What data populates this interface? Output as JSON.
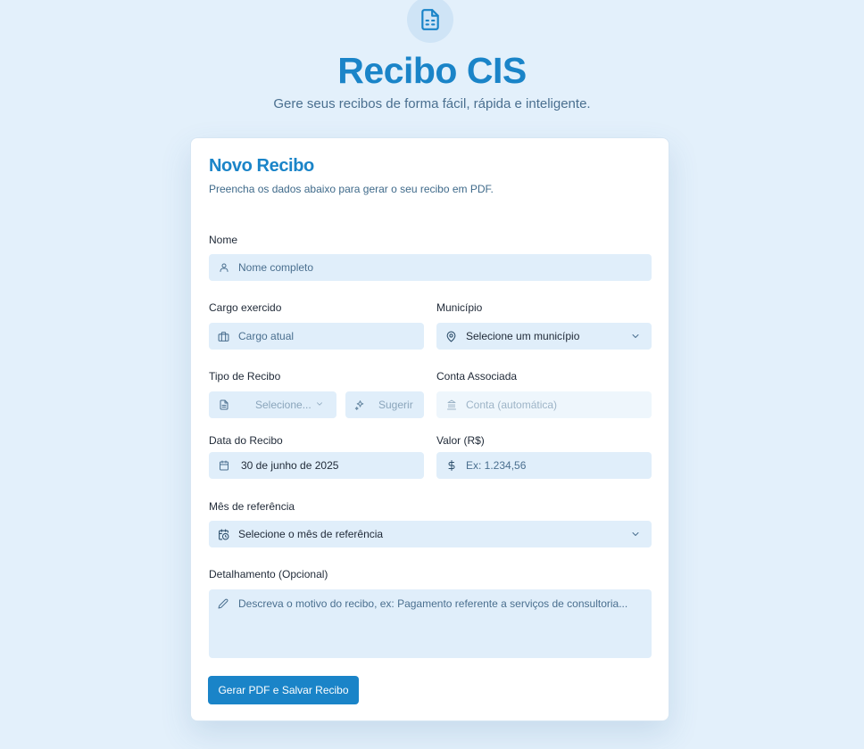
{
  "header": {
    "icon": "file-spreadsheet-icon",
    "title": "Recibo CIS",
    "subtitle": "Gere seus recibos de forma fácil, rápida e inteligente."
  },
  "form": {
    "title": "Novo Recibo",
    "description": "Preencha os dados abaixo para gerar o seu recibo em PDF.",
    "nome": {
      "label": "Nome",
      "placeholder": "Nome completo",
      "icon": "user-icon"
    },
    "cargo": {
      "label": "Cargo exercido",
      "placeholder": "Cargo atual",
      "icon": "briefcase-icon"
    },
    "municipio": {
      "label": "Município",
      "value": "Selecione um município",
      "icon": "map-pin-icon"
    },
    "tipo": {
      "label": "Tipo de Recibo",
      "value": "Selecione...",
      "icon": "file-icon",
      "suggest_label": "Sugerir",
      "suggest_icon": "sparkles-icon"
    },
    "conta": {
      "label": "Conta Associada",
      "placeholder": "Conta (automática)",
      "icon": "bank-icon"
    },
    "data": {
      "label": "Data do Recibo",
      "value": "30 de junho de 2025",
      "icon": "calendar-icon"
    },
    "valor": {
      "label": "Valor (R$)",
      "placeholder": "Ex: 1.234,56",
      "icon": "dollar-icon"
    },
    "mes": {
      "label": "Mês de referência",
      "value": "Selecione o mês de referência",
      "icon": "calendar-clock-icon"
    },
    "detalhe": {
      "label": "Detalhamento (Opcional)",
      "placeholder": "Descreva o motivo do recibo, ex: Pagamento referente a serviços de consultoria...",
      "icon": "pencil-icon"
    },
    "submit_label": "Gerar PDF e Salvar Recibo"
  },
  "colors": {
    "accent": "#1a84c8",
    "background": "#e3f0fb",
    "field_background": "#e0eefa"
  }
}
